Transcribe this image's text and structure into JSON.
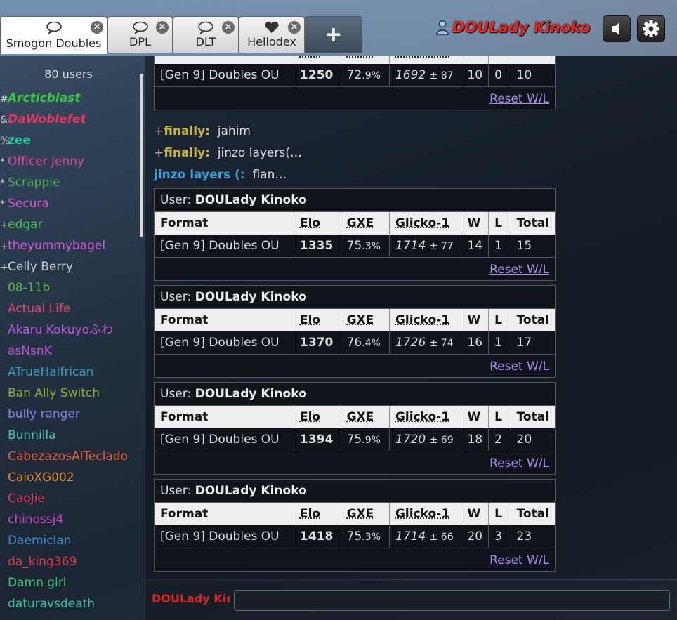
{
  "tabs": [
    {
      "label": "Smogon Doubles",
      "active": true
    },
    {
      "label": "DPL",
      "active": false
    },
    {
      "label": "DLT",
      "active": false
    },
    {
      "label": "Hellodex",
      "active": false
    }
  ],
  "header": {
    "username": "DOULady Kinoko",
    "plus_label": "+",
    "icons": [
      "user-icon",
      "volume-icon",
      "gear-icon"
    ]
  },
  "sidebar": {
    "user_count": "80 users",
    "users": [
      {
        "group": "#",
        "name": "Arcticblast",
        "color": "#35c83a",
        "style": "bi"
      },
      {
        "group": "&",
        "name": "DaWoblefet",
        "color": "#e5365b",
        "style": "bi"
      },
      {
        "group": "%",
        "name": "zee",
        "color": "#2cc79d",
        "style": "b"
      },
      {
        "group": "*",
        "name": "Officer Jenny",
        "color": "#e14792",
        "style": ""
      },
      {
        "group": "*",
        "name": "Scrappie",
        "color": "#4fae57",
        "style": ""
      },
      {
        "group": "*",
        "name": "Secura",
        "color": "#e24fcf",
        "style": ""
      },
      {
        "group": "+",
        "name": "edgar",
        "color": "#48c248",
        "style": ""
      },
      {
        "group": "+",
        "name": "theyummybagel",
        "color": "#d35ad8",
        "style": ""
      },
      {
        "group": "+",
        "name": "Celly Berry",
        "color": "#c7c7c7",
        "style": ""
      },
      {
        "group": "",
        "name": "08-11b",
        "color": "#58c248",
        "style": ""
      },
      {
        "group": "",
        "name": "Actual Life",
        "color": "#e54863",
        "style": ""
      },
      {
        "group": "",
        "name": "Akaru Kokuyoふわ",
        "color": "#c35ade",
        "style": ""
      },
      {
        "group": "",
        "name": "asNsnK",
        "color": "#c04fd6",
        "style": ""
      },
      {
        "group": "",
        "name": "ATrueHalfrican",
        "color": "#3b9cc2",
        "style": ""
      },
      {
        "group": "",
        "name": "Ban Ally Switch",
        "color": "#97a936",
        "style": ""
      },
      {
        "group": "",
        "name": "bully ranger",
        "color": "#8a7de6",
        "style": ""
      },
      {
        "group": "",
        "name": "Bunnilla",
        "color": "#47c7b9",
        "style": ""
      },
      {
        "group": "",
        "name": "CabezazosAlTeclado",
        "color": "#e0643a",
        "style": ""
      },
      {
        "group": "",
        "name": "CaioXG002",
        "color": "#e48a2e",
        "style": ""
      },
      {
        "group": "",
        "name": "CaoJie",
        "color": "#e5365b",
        "style": ""
      },
      {
        "group": "",
        "name": "chinossj4",
        "color": "#cb48c2",
        "style": ""
      },
      {
        "group": "",
        "name": "Daemiclan",
        "color": "#3e8ec8",
        "style": ""
      },
      {
        "group": "",
        "name": "da_king369",
        "color": "#e2374a",
        "style": ""
      },
      {
        "group": "",
        "name": "Damn girl",
        "color": "#3ac27c",
        "style": ""
      },
      {
        "group": "",
        "name": "daturavsdeath",
        "color": "#3ac2a0",
        "style": ""
      }
    ]
  },
  "chat": {
    "headers": [
      "Format",
      "Elo",
      "GXE",
      "Glicko-1",
      "W",
      "L",
      "Total"
    ],
    "reset_label": "Reset W/L",
    "user_label": "User:",
    "partial_box": {
      "format": "[Gen 9] Doubles OU",
      "elo": "1250",
      "gxe": "72",
      "gxe_dec": ".9%",
      "glicko": "1692",
      "dev": "± 87",
      "w": "10",
      "l": "0",
      "total": "10"
    },
    "messages": [
      {
        "sym": "+",
        "name": "finally:",
        "text": "jahim",
        "cls": "fin"
      },
      {
        "sym": "+",
        "name": "finally:",
        "text": "jinzo layers(…",
        "cls": "fin"
      },
      {
        "sym": "",
        "name": "jinzo layers (:",
        "text": "flan…",
        "cls": "jl"
      }
    ],
    "boxes": [
      {
        "user": "DOULady Kinoko",
        "format": "[Gen 9] Doubles OU",
        "elo": "1335",
        "gxe": "75",
        "gxe_dec": ".3%",
        "glicko": "1714",
        "dev": "± 77",
        "w": "14",
        "l": "1",
        "total": "15"
      },
      {
        "user": "DOULady Kinoko",
        "format": "[Gen 9] Doubles OU",
        "elo": "1370",
        "gxe": "76",
        "gxe_dec": ".4%",
        "glicko": "1726",
        "dev": "± 74",
        "w": "16",
        "l": "1",
        "total": "17"
      },
      {
        "user": "DOULady Kinoko",
        "format": "[Gen 9] Doubles OU",
        "elo": "1394",
        "gxe": "75",
        "gxe_dec": ".9%",
        "glicko": "1720",
        "dev": "± 69",
        "w": "18",
        "l": "2",
        "total": "20"
      },
      {
        "user": "DOULady Kinoko",
        "format": "[Gen 9] Doubles OU",
        "elo": "1418",
        "gxe": "75",
        "gxe_dec": ".3%",
        "glicko": "1714",
        "dev": "± 66",
        "w": "20",
        "l": "3",
        "total": "23"
      }
    ]
  },
  "input": {
    "name": "DOULady Kinoko",
    "value": ""
  }
}
